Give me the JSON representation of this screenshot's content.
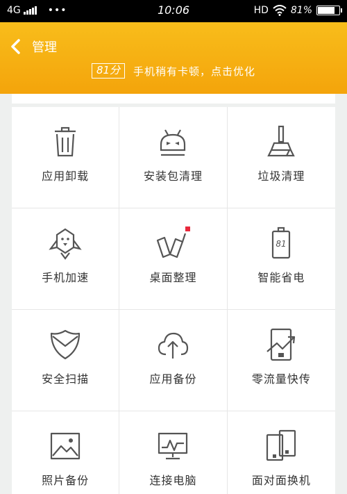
{
  "status_bar": {
    "network": "4G",
    "dots": "•••",
    "time": "10:06",
    "hd": "HD",
    "battery_text": "81%",
    "battery_level": 0.81
  },
  "header": {
    "title": "管理",
    "score": "81分",
    "tip": "手机稍有卡顿，点击优化",
    "color": "#f6ad12"
  },
  "tools": [
    {
      "label": "应用卸载",
      "icon": "trash-icon"
    },
    {
      "label": "安装包清理",
      "icon": "android-icon"
    },
    {
      "label": "垃圾清理",
      "icon": "broom-icon"
    },
    {
      "label": "手机加速",
      "icon": "rocket-icon"
    },
    {
      "label": "桌面整理",
      "icon": "desktop-organize-icon"
    },
    {
      "label": "智能省电",
      "icon": "battery-saver-icon"
    },
    {
      "label": "安全扫描",
      "icon": "shield-icon"
    },
    {
      "label": "应用备份",
      "icon": "cloud-upload-icon"
    },
    {
      "label": "零流量快传",
      "icon": "fast-transfer-icon"
    },
    {
      "label": "照片备份",
      "icon": "photo-icon"
    },
    {
      "label": "连接电脑",
      "icon": "computer-icon"
    },
    {
      "label": "面对面换机",
      "icon": "phone-switch-icon"
    }
  ],
  "icon_battery_text": "81",
  "badge_color": "#e8283c"
}
